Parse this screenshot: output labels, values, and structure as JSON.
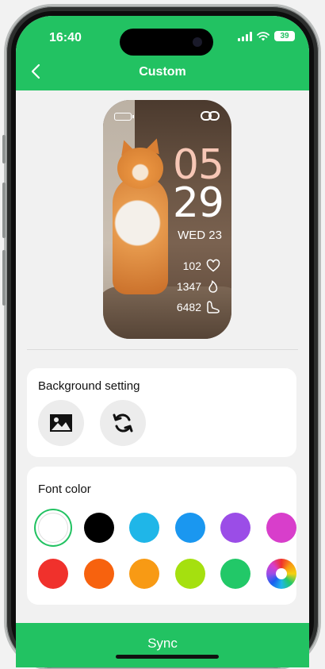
{
  "status": {
    "time": "16:40",
    "battery": "39"
  },
  "nav": {
    "title": "Custom"
  },
  "watch": {
    "hour": "05",
    "minute": "29",
    "weekday_date": "WED 23",
    "heart_rate": "102",
    "calories": "1347",
    "steps": "6482"
  },
  "background_card": {
    "title": "Background setting",
    "buttons": [
      {
        "icon": "image-icon"
      },
      {
        "icon": "refresh-icon"
      }
    ]
  },
  "font_card": {
    "title": "Font color",
    "selected_index": 0,
    "colors": [
      "#ffffff",
      "#000000",
      "#1fb6e8",
      "#1a97f0",
      "#9b4de7",
      "#d83ecb",
      "#f0312c",
      "#f7620e",
      "#f89a14",
      "#a5e00f",
      "#22c868",
      "rainbow"
    ]
  },
  "footer": {
    "sync_label": "Sync"
  }
}
